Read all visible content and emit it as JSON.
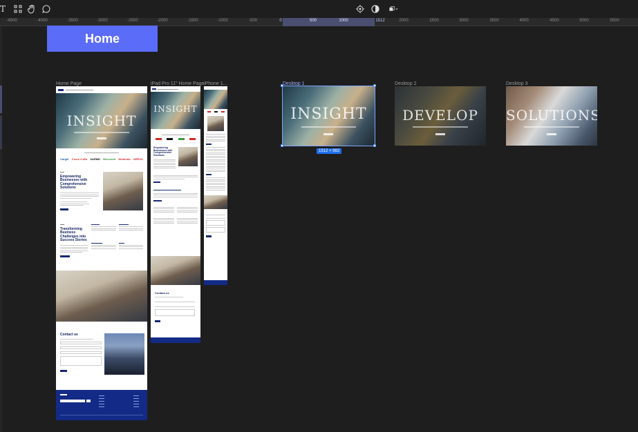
{
  "toolbar": {
    "left_icons": [
      "text-icon",
      "components-icon",
      "hand-icon",
      "comment-icon"
    ],
    "text_tool_label": "T",
    "right_icons": [
      "target-icon",
      "contrast-icon",
      "layers-icon"
    ]
  },
  "ruler": {
    "ticks": [
      "-4500",
      "-4000",
      "-3500",
      "-3000",
      "-2500",
      "-2000",
      "-1500",
      "-1000",
      "-500",
      "0",
      "500",
      "1000",
      "1512",
      "2000",
      "2500",
      "3000",
      "3500",
      "4000",
      "4500",
      "5000",
      "5500"
    ]
  },
  "banner": {
    "label": "Home"
  },
  "frames": {
    "home_page": {
      "title": "Home Page",
      "hero_word": "INSIGHT",
      "section1_title": "Empowering Businesses with Comprehensive Solutions",
      "section2_title": "Transforming Business Challenges into Success Stories",
      "contact_title": "Contact us",
      "brands": [
        "Cargill",
        "Coca-Cola",
        "SARMD",
        "Microsoft",
        "Nintendo",
        "XEROX"
      ]
    },
    "ipad": {
      "title": "iPad Pro 11\" Home Page",
      "hero_word": "INSIGHT",
      "section1_title": "Empowering Businesses with Comprehensive Solutions",
      "contact_title": "Contact us"
    },
    "iphone": {
      "title": "iPhone 1..."
    },
    "desktop1": {
      "title": "Desktop 1",
      "hero_word": "INSIGHT",
      "size_badge": "1512 × 982"
    },
    "desktop2": {
      "title": "Desktop 2",
      "hero_word": "DEVELOP"
    },
    "desktop3": {
      "title": "Desktop 3",
      "hero_word": "SOLUTIONS"
    }
  },
  "colors": {
    "banner": "#5b6cf8",
    "selection": "#1f6ff0",
    "navy": "#132a86",
    "canvas": "#1e1e1e"
  }
}
